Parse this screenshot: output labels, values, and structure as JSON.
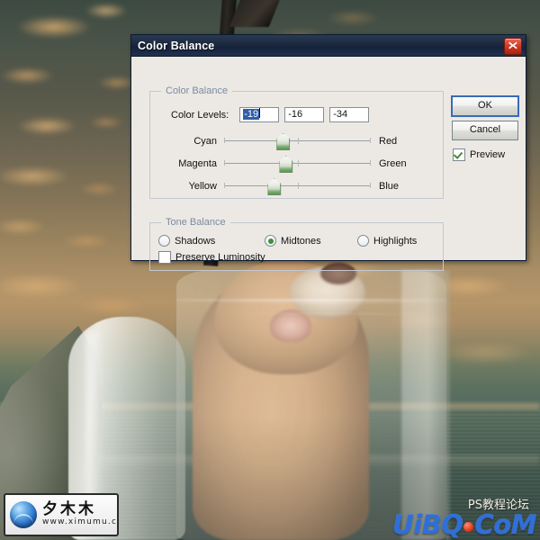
{
  "dialog": {
    "title": "Color Balance",
    "close_icon": "close-x-icon",
    "groups": {
      "color_balance": {
        "legend": "Color Balance",
        "levels_label": "Color Levels:",
        "levels": [
          {
            "value": "-19",
            "selected": true
          },
          {
            "value": "-16",
            "selected": false
          },
          {
            "value": "-34",
            "selected": false
          }
        ],
        "sliders": [
          {
            "left_label": "Cyan",
            "right_label": "Red",
            "position_pct": 40
          },
          {
            "left_label": "Magenta",
            "right_label": "Green",
            "position_pct": 42
          },
          {
            "left_label": "Yellow",
            "right_label": "Blue",
            "position_pct": 34
          }
        ]
      },
      "tone_balance": {
        "legend": "Tone Balance",
        "options": [
          {
            "label": "Shadows",
            "selected": false
          },
          {
            "label": "Midtones",
            "selected": true
          },
          {
            "label": "Highlights",
            "selected": false
          }
        ],
        "preserve_luminosity": {
          "label": "Preserve Luminosity",
          "checked": false
        }
      }
    },
    "buttons": {
      "ok": "OK",
      "cancel": "Cancel"
    },
    "preview": {
      "label": "Preview",
      "checked": true
    }
  },
  "watermarks": {
    "logo": {
      "name": "夕木木",
      "url": "www.ximumu.cn"
    },
    "forum": {
      "line1": "PS教程论坛",
      "brand_left": "UiBQ",
      "brand_right": "CoM"
    }
  },
  "colors": {
    "titlebar": "#1d2b42",
    "dialog_face": "#ece9e4",
    "legend_text": "#7b8aa2",
    "selection_blue": "#2f5fa8",
    "slider_green": "#4e9046",
    "close_red": "#cf3a26",
    "brand_blue": "#2f6fd8",
    "brand_red": "#e23b1c"
  }
}
